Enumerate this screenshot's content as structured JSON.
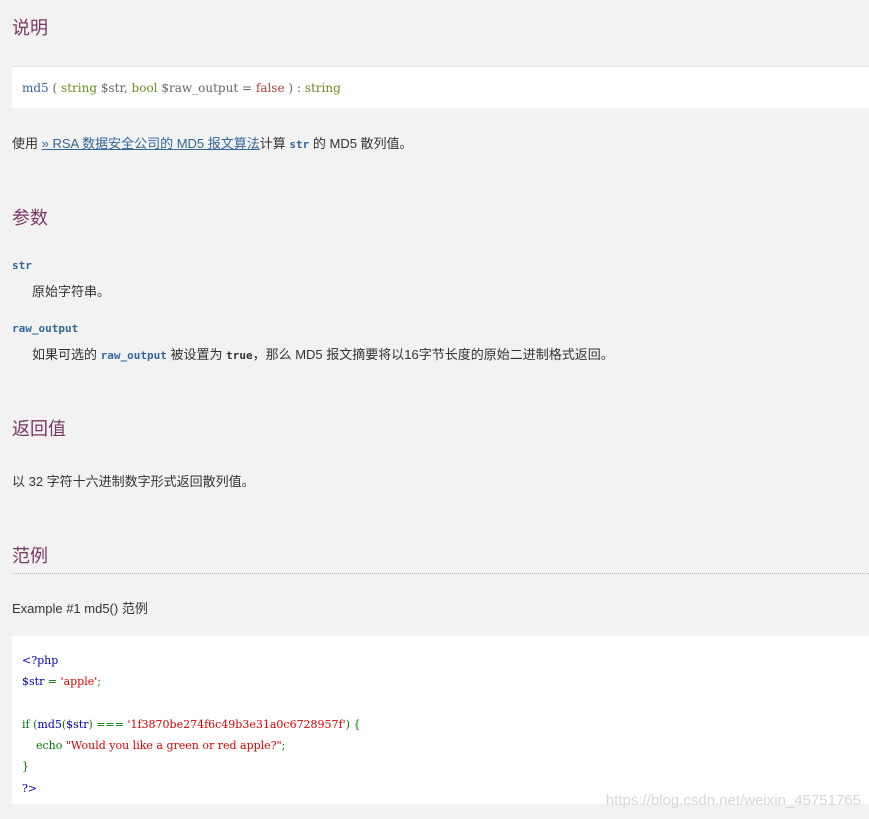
{
  "sections": {
    "description": "说明",
    "parameters": "参数",
    "return_values": "返回值",
    "examples": "范例"
  },
  "signature": {
    "function": "md5",
    "open": "(",
    "param1_type": "string",
    "param1_name": "$str",
    "comma": ",",
    "param2_type": "bool",
    "param2_name": "$raw_output",
    "equals": "=",
    "param2_default": "false",
    "close": ")",
    "colon": ":",
    "return_type": "string"
  },
  "description": {
    "prefix": "使用 ",
    "link": "» RSA 数据安全公司的 MD5 报文算法",
    "middle": "计算 ",
    "code": "str",
    "suffix": " 的 MD5 散列值。"
  },
  "parameters": [
    {
      "name": "str",
      "desc": "原始字符串。"
    },
    {
      "name": "raw_output",
      "desc_prefix": "如果可选的 ",
      "desc_code1": "raw_output",
      "desc_middle": " 被设置为 ",
      "desc_code2": "true",
      "desc_suffix": "，那么 MD5 报文摘要将以16字节长度的原始二进制格式返回。"
    }
  ],
  "return_text": "以 32 字符十六进制数字形式返回散列值。",
  "example": {
    "title": "Example #1 md5() 范例",
    "code": {
      "line1": "<?php",
      "line2_var": "$str",
      "line2_op": " = ",
      "line2_str": "'apple'",
      "line2_end": ";",
      "line4_if": "if (",
      "line4_fn": "md5",
      "line4_paren": "(",
      "line4_var": "$str",
      "line4_op": ") === ",
      "line4_str": "'1f3870be274f6c49b3e31a0c6728957f'",
      "line4_end": ") {",
      "line5_indent": "    ",
      "line5_echo": "echo ",
      "line5_str": "\"Would you like a green or red apple?\"",
      "line5_end": ";",
      "line6": "}",
      "line7": "?>"
    }
  },
  "watermark": "https://blog.csdn.net/weixin_45751765"
}
